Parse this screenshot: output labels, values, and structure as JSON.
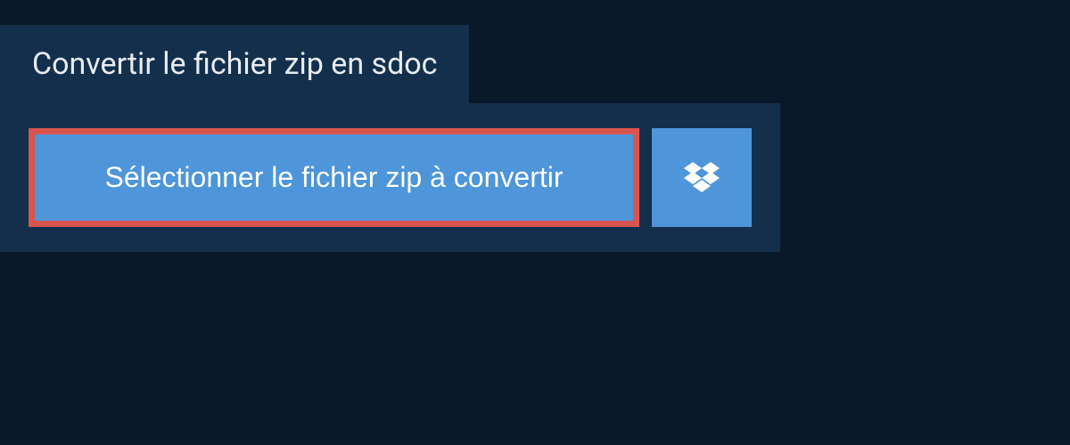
{
  "tab": {
    "title": "Convertir le fichier zip en sdoc"
  },
  "actions": {
    "select_file_label": "Sélectionner le fichier zip à convertir"
  }
}
